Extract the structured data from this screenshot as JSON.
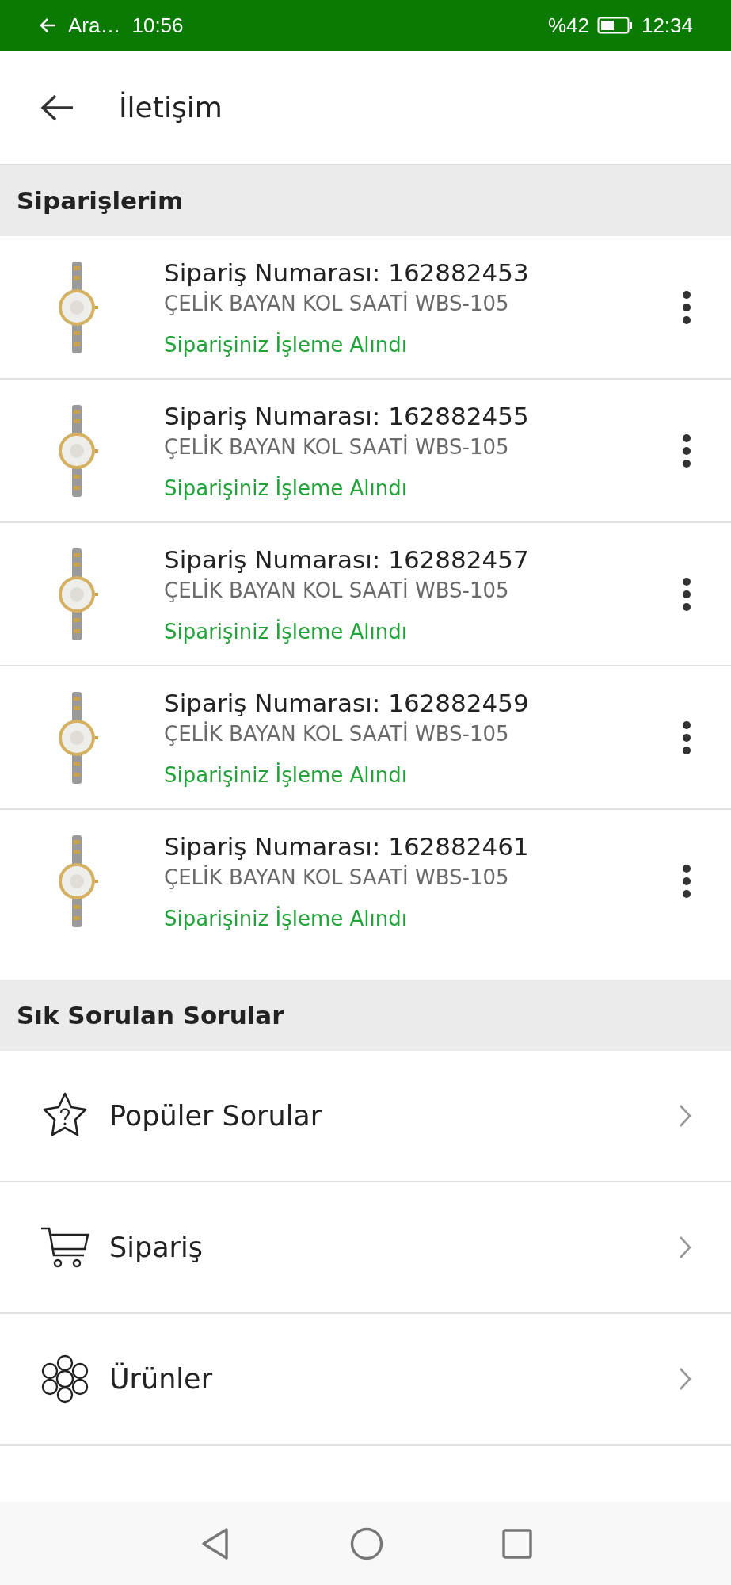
{
  "status_bar": {
    "back_app": "Ara…",
    "left_time": "10:56",
    "battery": "%42",
    "time": "12:34"
  },
  "header": {
    "title": "İletişim"
  },
  "orders_section": {
    "title": "Siparişlerim",
    "orders": [
      {
        "number": "Sipariş Numarası: 162882453",
        "product": "ÇELİK BAYAN KOL SAATİ WBS-105",
        "status": "Siparişiniz İşleme Alındı"
      },
      {
        "number": "Sipariş Numarası: 162882455",
        "product": "ÇELİK BAYAN KOL SAATİ WBS-105",
        "status": "Siparişiniz İşleme Alındı"
      },
      {
        "number": "Sipariş Numarası: 162882457",
        "product": "ÇELİK BAYAN KOL SAATİ WBS-105",
        "status": "Siparişiniz İşleme Alındı"
      },
      {
        "number": "Sipariş Numarası: 162882459",
        "product": "ÇELİK BAYAN KOL SAATİ WBS-105",
        "status": "Siparişiniz İşleme Alındı"
      },
      {
        "number": "Sipariş Numarası: 162882461",
        "product": "ÇELİK BAYAN KOL SAATİ WBS-105",
        "status": "Siparişiniz İşleme Alındı"
      }
    ]
  },
  "faq_section": {
    "title": "Sık Sorulan Sorular",
    "items": [
      {
        "label": "Popüler Sorular",
        "kind": "star"
      },
      {
        "label": "Sipariş",
        "kind": "cart"
      },
      {
        "label": "Ürünler",
        "kind": "flower"
      }
    ]
  }
}
